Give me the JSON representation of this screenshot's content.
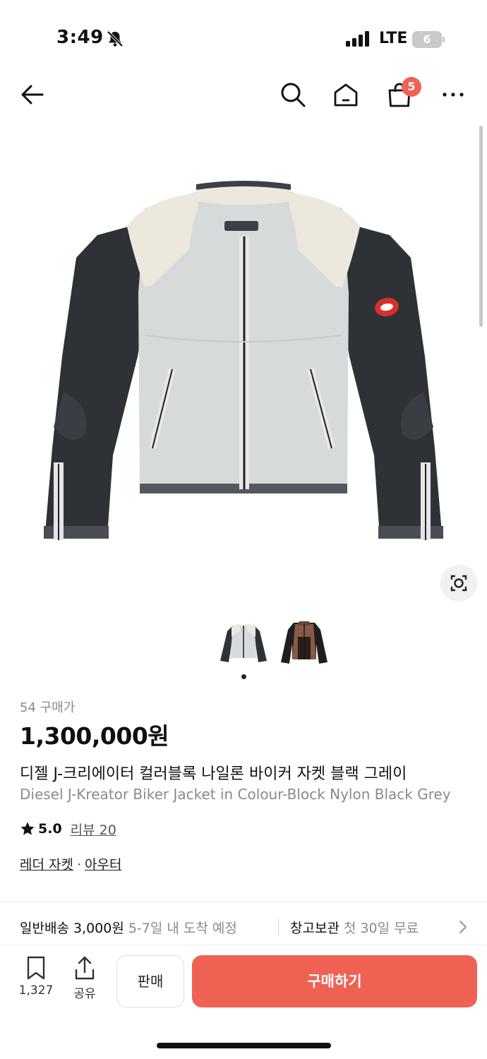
{
  "status_bar": {
    "time": "3:49",
    "network": "LTE",
    "battery": "6"
  },
  "nav": {
    "cart_count": "5"
  },
  "product": {
    "purchase_count": "54 구매가",
    "price": "1,300,000원",
    "name_ko": "디젤 J-크리에이터 컬러블록 나일론 바이커 자켓 블랙 그레이",
    "name_en": "Diesel J-Kreator Biker Jacket in Colour-Block Nylon Black Grey",
    "rating": "5.0",
    "review_label": "리뷰 20",
    "categories": [
      "레더 자켓",
      "아우터"
    ],
    "category_sep": "·",
    "image_count": 2,
    "active_image_index": 0
  },
  "shipping": {
    "label": "일반배송 3,000원",
    "info": "5-7일 내 도착 예정",
    "storage_label": "창고보관",
    "storage_info": "첫 30일 무료"
  },
  "bottom_bar": {
    "bookmark_count": "1,327",
    "share_label": "공유",
    "sell_label": "판매",
    "buy_label": "구매하기"
  },
  "colors": {
    "accent": "#ef6253",
    "muted_text": "#8a8a8a"
  },
  "icons": [
    "bell-off-icon",
    "signal-icon",
    "battery-icon",
    "back-arrow-icon",
    "search-icon",
    "home-icon",
    "cart-icon",
    "more-icon",
    "lens-icon",
    "star-icon",
    "chevron-right-icon",
    "bookmark-icon",
    "share-icon"
  ]
}
